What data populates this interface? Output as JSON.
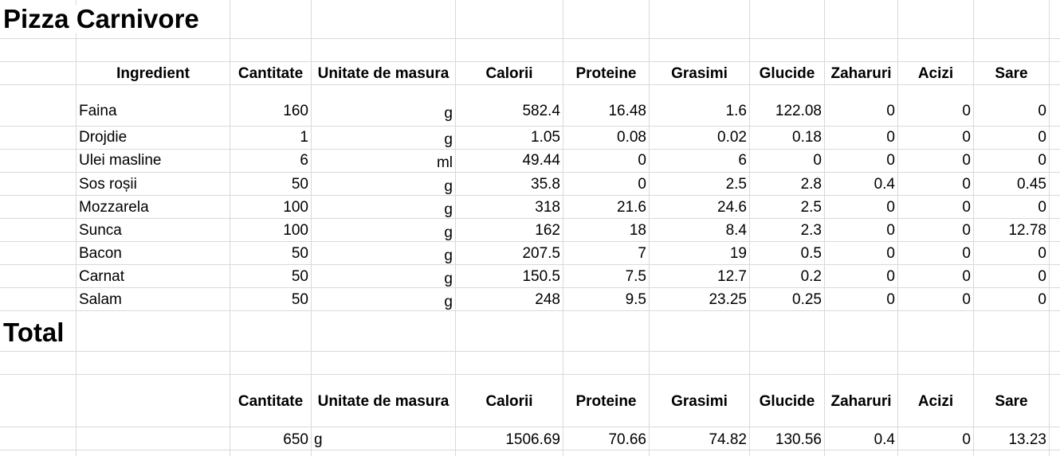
{
  "sheet": {
    "title": "Pizza Carnivore",
    "total_title": "Total"
  },
  "headers": [
    "Ingredient",
    "Cantitate",
    "Unitate de masura",
    "Calorii",
    "Proteine",
    "Grasimi",
    "Glucide",
    "Zaharuri",
    "Acizi",
    "Sare"
  ],
  "rows": [
    {
      "ingredient": "Faina",
      "cantitate": "160",
      "unitate": "g",
      "calorii": "582.4",
      "proteine": "16.48",
      "grasimi": "1.6",
      "glucide": "122.08",
      "zaharuri": "0",
      "acizi": "0",
      "sare": "0"
    },
    {
      "ingredient": "Drojdie",
      "cantitate": "1",
      "unitate": "g",
      "calorii": "1.05",
      "proteine": "0.08",
      "grasimi": "0.02",
      "glucide": "0.18",
      "zaharuri": "0",
      "acizi": "0",
      "sare": "0"
    },
    {
      "ingredient": "Ulei masline",
      "cantitate": "6",
      "unitate": "ml",
      "calorii": "49.44",
      "proteine": "0",
      "grasimi": "6",
      "glucide": "0",
      "zaharuri": "0",
      "acizi": "0",
      "sare": "0"
    },
    {
      "ingredient": "Sos roșii",
      "cantitate": "50",
      "unitate": "g",
      "calorii": "35.8",
      "proteine": "0",
      "grasimi": "2.5",
      "glucide": "2.8",
      "zaharuri": "0.4",
      "acizi": "0",
      "sare": "0.45"
    },
    {
      "ingredient": "Mozzarela",
      "cantitate": "100",
      "unitate": "g",
      "calorii": "318",
      "proteine": "21.6",
      "grasimi": "24.6",
      "glucide": "2.5",
      "zaharuri": "0",
      "acizi": "0",
      "sare": "0"
    },
    {
      "ingredient": "Sunca",
      "cantitate": "100",
      "unitate": "g",
      "calorii": "162",
      "proteine": "18",
      "grasimi": "8.4",
      "glucide": "2.3",
      "zaharuri": "0",
      "acizi": "0",
      "sare": "12.78"
    },
    {
      "ingredient": "Bacon",
      "cantitate": "50",
      "unitate": "g",
      "calorii": "207.5",
      "proteine": "7",
      "grasimi": "19",
      "glucide": "0.5",
      "zaharuri": "0",
      "acizi": "0",
      "sare": "0"
    },
    {
      "ingredient": "Carnat",
      "cantitate": "50",
      "unitate": "g",
      "calorii": "150.5",
      "proteine": "7.5",
      "grasimi": "12.7",
      "glucide": "0.2",
      "zaharuri": "0",
      "acizi": "0",
      "sare": "0"
    },
    {
      "ingredient": "Salam",
      "cantitate": "50",
      "unitate": "g",
      "calorii": "248",
      "proteine": "9.5",
      "grasimi": "23.25",
      "glucide": "0.25",
      "zaharuri": "0",
      "acizi": "0",
      "sare": "0"
    }
  ],
  "total_headers": [
    "Cantitate",
    "Unitate de masura",
    "Calorii",
    "Proteine",
    "Grasimi",
    "Glucide",
    "Zaharuri",
    "Acizi",
    "Sare"
  ],
  "totals": {
    "cantitate": "650",
    "unitate": "g",
    "calorii": "1506.69",
    "proteine": "70.66",
    "grasimi": "74.82",
    "glucide": "130.56",
    "zaharuri": "0.4",
    "acizi": "0",
    "sare": "13.23"
  }
}
